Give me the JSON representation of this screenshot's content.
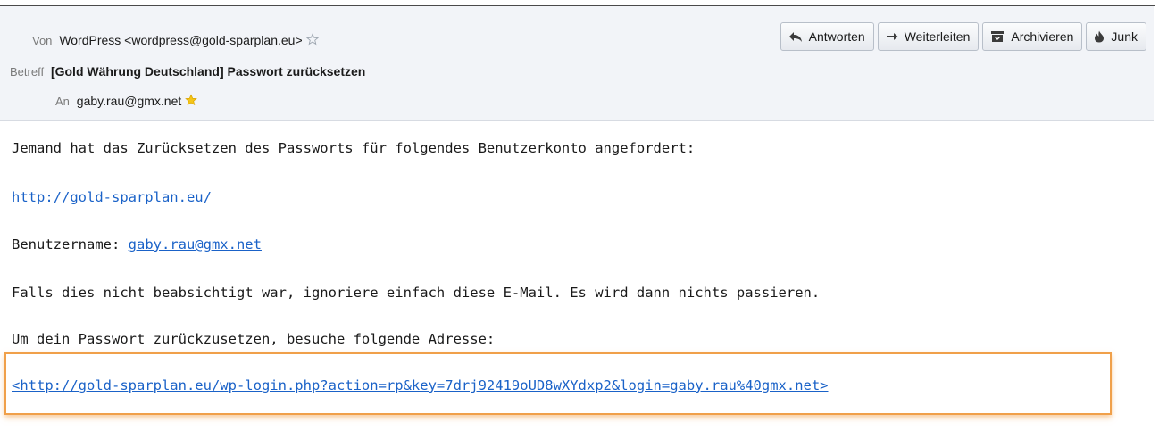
{
  "header": {
    "from_label": "Von",
    "from_value": "WordPress <wordpress@gold-sparplan.eu>",
    "subject_label": "Betreff",
    "subject_value": "[Gold Währung Deutschland] Passwort zurücksetzen",
    "to_label": "An",
    "to_value": "gaby.rau@gmx.net"
  },
  "toolbar": {
    "reply_label": "Antworten",
    "forward_label": "Weiterleiten",
    "archive_label": "Archivieren",
    "junk_label": "Junk"
  },
  "message": {
    "line1": "Jemand hat das Zurücksetzen des Passworts für folgendes Benutzerkonto angefordert:",
    "site_link": "http://gold-sparplan.eu/",
    "username_label": "Benutzername: ",
    "username_link": "gaby.rau@gmx.net",
    "line_ignore": "Falls dies nicht beabsichtigt war, ignoriere einfach diese E-Mail. Es wird dann nichts passieren.",
    "line_reset": "Um dein Passwort zurückzusetzen, besuche folgende Adresse:",
    "reset_link": "<http://gold-sparplan.eu/wp-login.php?action=rp&key=7drj92419oUD8wXYdxp2&login=gaby.rau%40gmx.net>"
  },
  "colors": {
    "highlight": "#f0a04a",
    "link": "#1a62c8"
  }
}
